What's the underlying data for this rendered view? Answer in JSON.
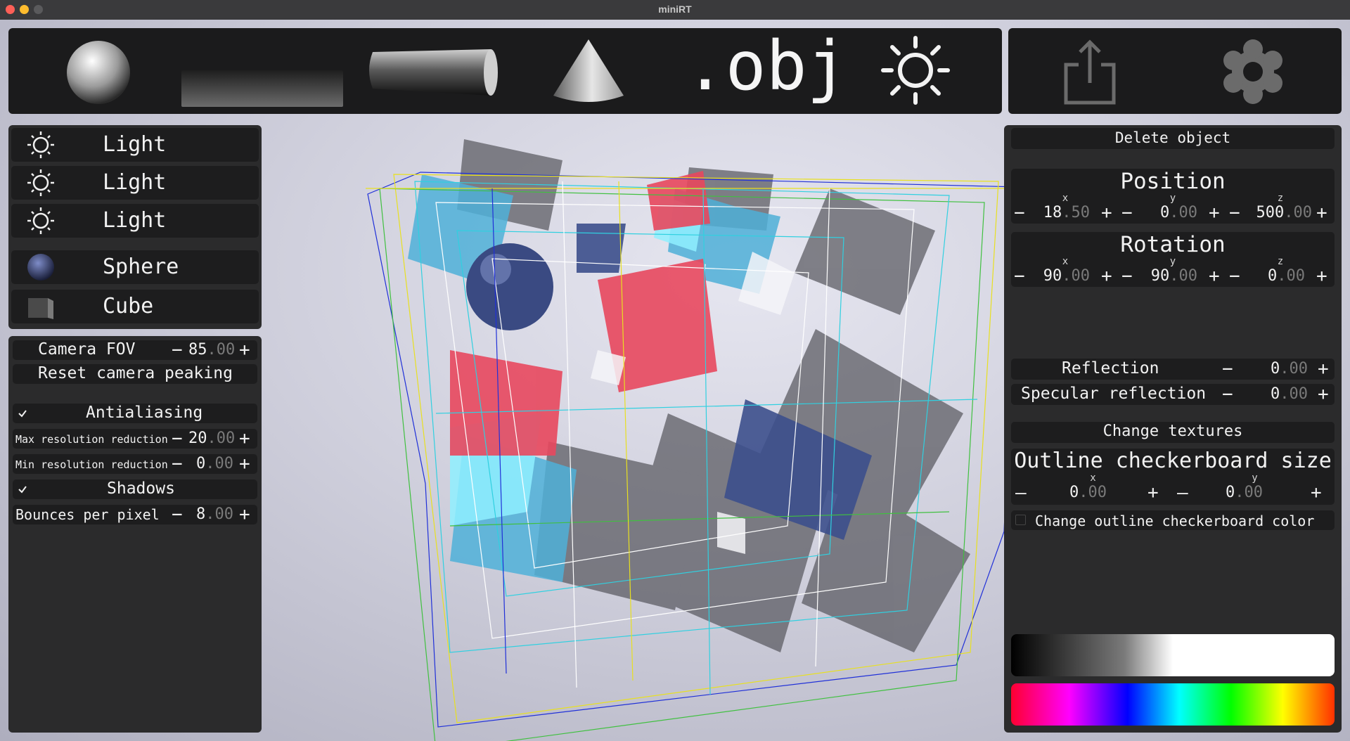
{
  "window": {
    "title": "miniRT"
  },
  "toolbar": {
    "items": [
      {
        "name": "sphere",
        "label": ""
      },
      {
        "name": "plane",
        "label": ""
      },
      {
        "name": "cylinder",
        "label": ""
      },
      {
        "name": "cone",
        "label": ""
      },
      {
        "name": "obj",
        "label": ".obj"
      },
      {
        "name": "light",
        "label": ""
      }
    ],
    "export_icon": "export-icon",
    "settings_icon": "gear-icon"
  },
  "objects": [
    {
      "icon": "sun-icon",
      "label": "Light"
    },
    {
      "icon": "sun-icon",
      "label": "Light"
    },
    {
      "icon": "sun-icon",
      "label": "Light"
    },
    {
      "icon": "sphere-icon",
      "label": "Sphere"
    },
    {
      "icon": "cube-icon",
      "label": "Cube"
    }
  ],
  "camera": {
    "fov_label": "Camera FOV",
    "fov_int": "85",
    "fov_dec": ".00",
    "reset_label": "Reset camera peaking",
    "antialiasing_label": "Antialiasing",
    "antialiasing_checked": true,
    "max_res_label": "Max resolution reduction",
    "max_res_int": "20",
    "max_res_dec": ".00",
    "min_res_label": "Min resolution reduction",
    "min_res_int": "0",
    "min_res_dec": ".00",
    "shadows_label": "Shadows",
    "shadows_checked": true,
    "bounces_label": "Bounces per pixel",
    "bounces_int": "8",
    "bounces_dec": ".00"
  },
  "properties": {
    "delete_label": "Delete object",
    "position_label": "Position",
    "position": {
      "x_label": "x",
      "x_int": "18",
      "x_dec": ".50",
      "y_label": "y",
      "y_int": "0",
      "y_dec": ".00",
      "z_label": "z",
      "z_int": "500",
      "z_dec": ".00"
    },
    "rotation_label": "Rotation",
    "rotation": {
      "x_label": "x",
      "x_int": "90",
      "x_dec": ".00",
      "y_label": "y",
      "y_int": "90",
      "y_dec": ".00",
      "z_label": "z",
      "z_int": "0",
      "z_dec": ".00"
    },
    "reflection_label": "Reflection",
    "reflection_int": "0",
    "reflection_dec": ".00",
    "specular_label": "Specular reflection",
    "specular_int": "0",
    "specular_dec": ".00",
    "textures_label": "Change textures",
    "checker_label": "Outline checkerboard size",
    "checker": {
      "x_label": "x",
      "x_int": "0",
      "x_dec": ".00",
      "y_label": "y",
      "y_int": "0",
      "y_dec": ".00"
    },
    "checker_color_label": "Change outline checkerboard color",
    "checker_color_checked": false
  },
  "colors": {
    "close": "#fe5f57",
    "minimize": "#febc2e",
    "maximize": "#5a5a5c",
    "panel": "#2b2b2c",
    "row": "#1d1d1e"
  }
}
